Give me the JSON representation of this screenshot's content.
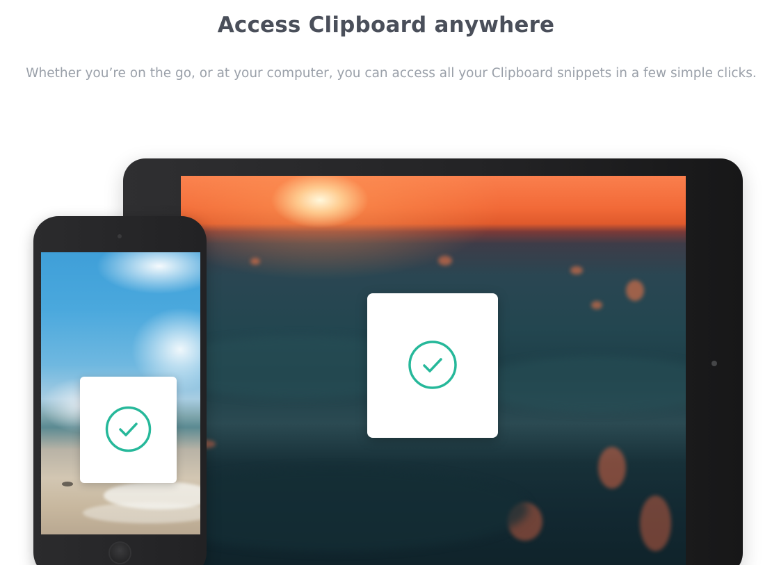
{
  "section": {
    "title": "Access Clipboard anywhere",
    "description": "Whether you’re on the go, or at your computer, you can access all your Clipboard snippets in a few simple clicks."
  },
  "devices": {
    "tablet": {
      "screen_image": "ocean-sunset-photo",
      "card_icon": "checkmark-circle-icon"
    },
    "phone": {
      "screen_image": "beach-sky-photo",
      "card_icon": "checkmark-circle-icon"
    }
  },
  "colors": {
    "heading": "#4a4f5a",
    "body_text": "#9aa0a9",
    "accent": "#26b89a",
    "device_frame": "#232325"
  }
}
